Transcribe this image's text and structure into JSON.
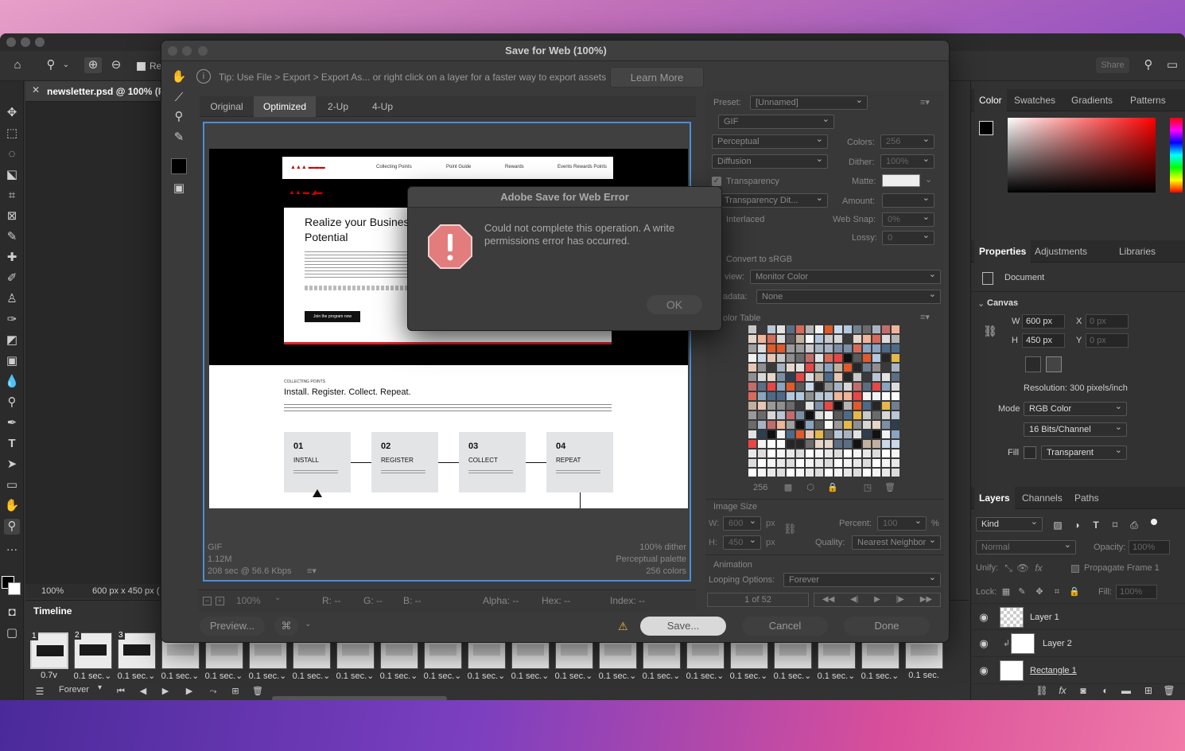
{
  "app": {
    "doc_tab": "newsletter.psd @ 100% (R",
    "opt_checkbox_label": "Re",
    "share": "Share",
    "status_zoom": "100%",
    "status_size": "600 px x 450 px (",
    "timeline_title": "Timeline",
    "timeline_loop": "Forever",
    "frames": [
      {
        "n": "1",
        "t": "0.7v"
      },
      {
        "n": "2",
        "t": "0.1 sec.⌄"
      },
      {
        "n": "3",
        "t": "0.1 sec.⌄"
      },
      {
        "n": "",
        "t": "0.1 sec.⌄"
      },
      {
        "n": "",
        "t": "0.1 sec.⌄"
      },
      {
        "n": "",
        "t": "0.1 sec.⌄"
      },
      {
        "n": "",
        "t": "0.1 sec.⌄"
      },
      {
        "n": "",
        "t": "0.1 sec.⌄"
      },
      {
        "n": "",
        "t": "0.1 sec.⌄"
      },
      {
        "n": "",
        "t": "0.1 sec.⌄"
      },
      {
        "n": "",
        "t": "0.1 sec.⌄"
      },
      {
        "n": "",
        "t": "0.1 sec.⌄"
      },
      {
        "n": "",
        "t": "0.1 sec.⌄"
      },
      {
        "n": "",
        "t": "0.1 sec.⌄"
      },
      {
        "n": "",
        "t": "0.1 sec.⌄"
      },
      {
        "n": "",
        "t": "0.1 sec.⌄"
      },
      {
        "n": "",
        "t": "0.1 sec.⌄"
      },
      {
        "n": "",
        "t": "0.1 sec.⌄"
      },
      {
        "n": "",
        "t": "0.1 sec.⌄"
      },
      {
        "n": "",
        "t": "0.1 sec.⌄"
      },
      {
        "n": "",
        "t": "0.1 sec."
      }
    ]
  },
  "color_panel": {
    "tabs": [
      "Color",
      "Swatches",
      "Gradients",
      "Patterns"
    ]
  },
  "properties": {
    "tabs": [
      "Properties",
      "Adjustments",
      "Libraries"
    ],
    "document": "Document",
    "canvas": "Canvas",
    "w_label": "W",
    "w": "600 px",
    "x_label": "X",
    "x": "0 px",
    "h_label": "H",
    "h": "450 px",
    "y_label": "Y",
    "y": "0 px",
    "resolution": "Resolution: 300 pixels/inch",
    "mode_label": "Mode",
    "mode": "RGB Color",
    "bits": "16 Bits/Channel",
    "fill_label": "Fill",
    "fill": "Transparent"
  },
  "layers": {
    "tabs": [
      "Layers",
      "Channels",
      "Paths"
    ],
    "kind": "Kind",
    "blend": "Normal",
    "opacity_label": "Opacity:",
    "opacity": "100%",
    "unify": "Unify:",
    "propagate": "Propagate Frame 1",
    "lock": "Lock:",
    "fill_label": "Fill:",
    "fill": "100%",
    "items": [
      "Layer 1",
      "Layer 2",
      "Rectangle 1"
    ]
  },
  "sfw": {
    "title": "Save for Web (100%)",
    "tip": "Tip: Use File > Export > Export As...  or right click on a layer for a faster way to export assets",
    "learn_more": "Learn More",
    "tabs": [
      "Original",
      "Optimized",
      "2-Up",
      "4-Up"
    ],
    "preset_label": "Preset:",
    "preset": "[Unnamed]",
    "format": "GIF",
    "reduction": "Perceptual",
    "colors_label": "Colors:",
    "colors": "256",
    "dither_algo": "Diffusion",
    "dither_label": "Dither:",
    "dither": "100%",
    "transparency": "Transparency",
    "matte_label": "Matte:",
    "trans_dither": "o Transparency Dit...",
    "amount_label": "Amount:",
    "interlaced": "Interlaced",
    "websnap_label": "Web Snap:",
    "websnap": "0%",
    "lossy_label": "Lossy:",
    "lossy": "0",
    "convert": "Convert to sRGB",
    "preview_label": "view:",
    "preview_val": "Monitor Color",
    "metadata_label": "adata:",
    "metadata_val": "None",
    "color_table": "olor Table",
    "ct_count": "256",
    "image_size": "Image Size",
    "is_w_label": "W:",
    "is_w": "600",
    "is_h_label": "H:",
    "is_h": "450",
    "px": "px",
    "percent_label": "Percent:",
    "percent": "100",
    "pct": "%",
    "quality_label": "Quality:",
    "quality": "Nearest Neighbor",
    "animation": "Animation",
    "looping_label": "Looping Options:",
    "looping": "Forever",
    "frame_counter": "1 of 52",
    "info_left": [
      "GIF",
      "1.12M",
      "208 sec @ 56.6 Kbps"
    ],
    "info_right": [
      "100% dither",
      "Perceptual palette",
      "256 colors"
    ],
    "zoom": "100%",
    "r": "R: --",
    "g": "G: --",
    "b": "B: --",
    "alpha": "Alpha: --",
    "hex": "Hex: --",
    "index": "Index: --",
    "preview_btn": "Preview...",
    "save": "Save...",
    "cancel": "Cancel",
    "done": "Done"
  },
  "newsletter": {
    "nav": [
      "Collecting Points",
      "Point Guide",
      "Rewards",
      "Events Rewards Points"
    ],
    "headline1": "Realize your Business",
    "headline2": "Potential",
    "join": "Join the program now",
    "kicker": "COLLECTING POINTS",
    "h2": "Install. Register. Collect. Repeat.",
    "steps": [
      {
        "n": "01",
        "t": "INSTALL"
      },
      {
        "n": "02",
        "t": "REGISTER"
      },
      {
        "n": "03",
        "t": "COLLECT"
      },
      {
        "n": "04",
        "t": "REPEAT"
      }
    ]
  },
  "error": {
    "title": "Adobe Save for Web Error",
    "message": "Could not complete this operation. A write permissions error has occurred.",
    "ok": "OK"
  },
  "colors": {
    "accent": "#4a8fd6",
    "error_red": "#e05a5a"
  }
}
